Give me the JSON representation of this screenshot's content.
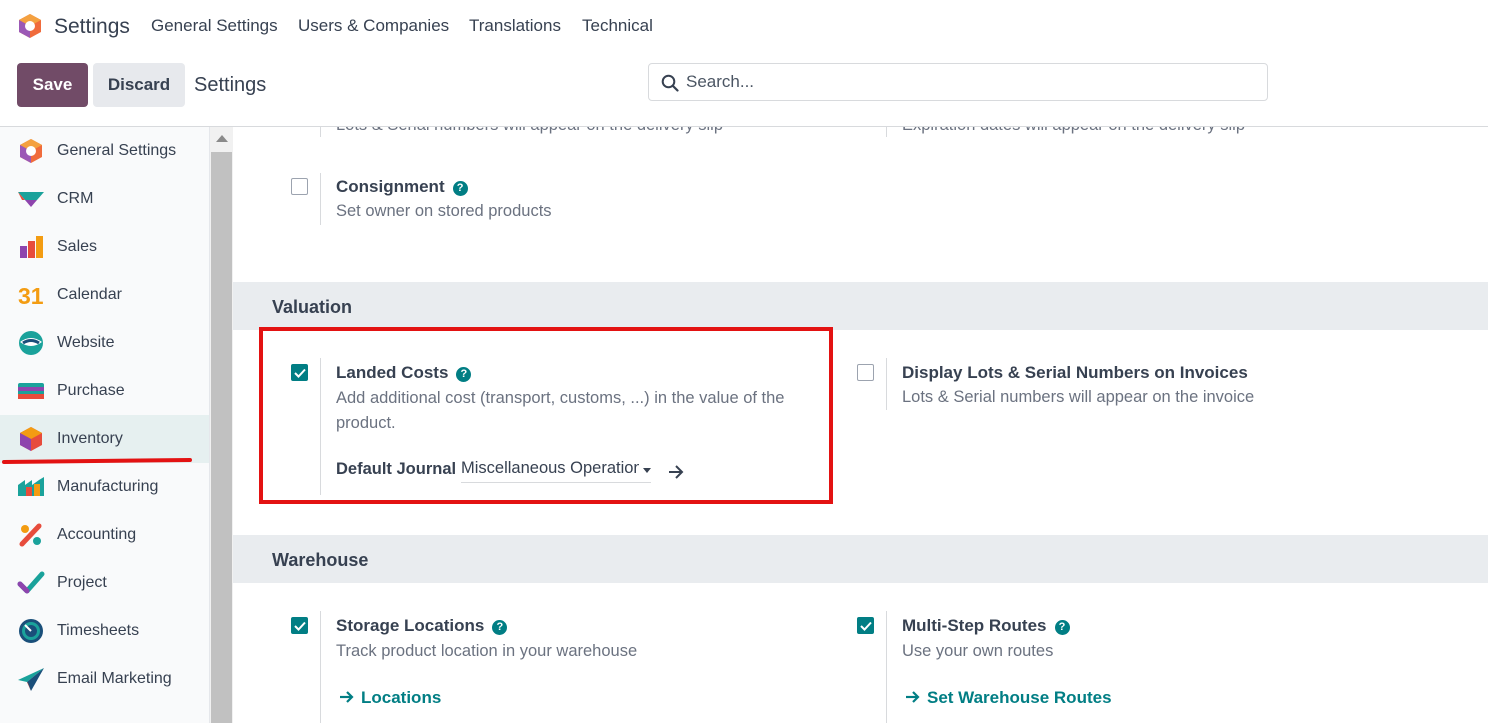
{
  "topbar": {
    "app_title": "Settings",
    "menu": [
      "General Settings",
      "Users & Companies",
      "Translations",
      "Technical"
    ]
  },
  "control": {
    "save_label": "Save",
    "discard_label": "Discard",
    "breadcrumb": "Settings",
    "search_placeholder": "Search..."
  },
  "sidebar": {
    "items": [
      {
        "label": "General Settings",
        "icon": "settings-icon"
      },
      {
        "label": "CRM",
        "icon": "crm-icon"
      },
      {
        "label": "Sales",
        "icon": "sales-icon"
      },
      {
        "label": "Calendar",
        "icon": "calendar-icon",
        "icon_text": "31"
      },
      {
        "label": "Website",
        "icon": "website-icon"
      },
      {
        "label": "Purchase",
        "icon": "purchase-icon"
      },
      {
        "label": "Inventory",
        "icon": "inventory-icon",
        "active": true
      },
      {
        "label": "Manufacturing",
        "icon": "manufacturing-icon"
      },
      {
        "label": "Accounting",
        "icon": "accounting-icon"
      },
      {
        "label": "Project",
        "icon": "project-icon"
      },
      {
        "label": "Timesheets",
        "icon": "timesheets-icon"
      },
      {
        "label": "Email Marketing",
        "icon": "email-marketing-icon"
      }
    ]
  },
  "content": {
    "cut_left": "Lots & Serial numbers will appear on the delivery slip",
    "cut_right": "Expiration dates will appear on the delivery slip",
    "consignment": {
      "title": "Consignment",
      "desc": "Set owner on stored products",
      "checked": false
    },
    "valuation": {
      "heading": "Valuation",
      "landed_costs": {
        "title": "Landed Costs",
        "desc": "Add additional cost (transport, customs, ...) in the value of the product.",
        "checked": true,
        "journal_label": "Default Journal",
        "journal_value": "Miscellaneous Operations"
      },
      "lots_invoices": {
        "title": "Display Lots & Serial Numbers on Invoices",
        "desc": "Lots & Serial numbers will appear on the invoice",
        "checked": false
      }
    },
    "warehouse": {
      "heading": "Warehouse",
      "storage": {
        "title": "Storage Locations",
        "desc": "Track product location in your warehouse",
        "link": "Locations",
        "checked": true
      },
      "routes": {
        "title": "Multi-Step Routes",
        "desc": "Use your own routes",
        "link": "Set Warehouse Routes",
        "checked": true
      }
    }
  },
  "colors": {
    "accent": "#714b67",
    "teal": "#017e84",
    "annotation": "#e31212"
  }
}
